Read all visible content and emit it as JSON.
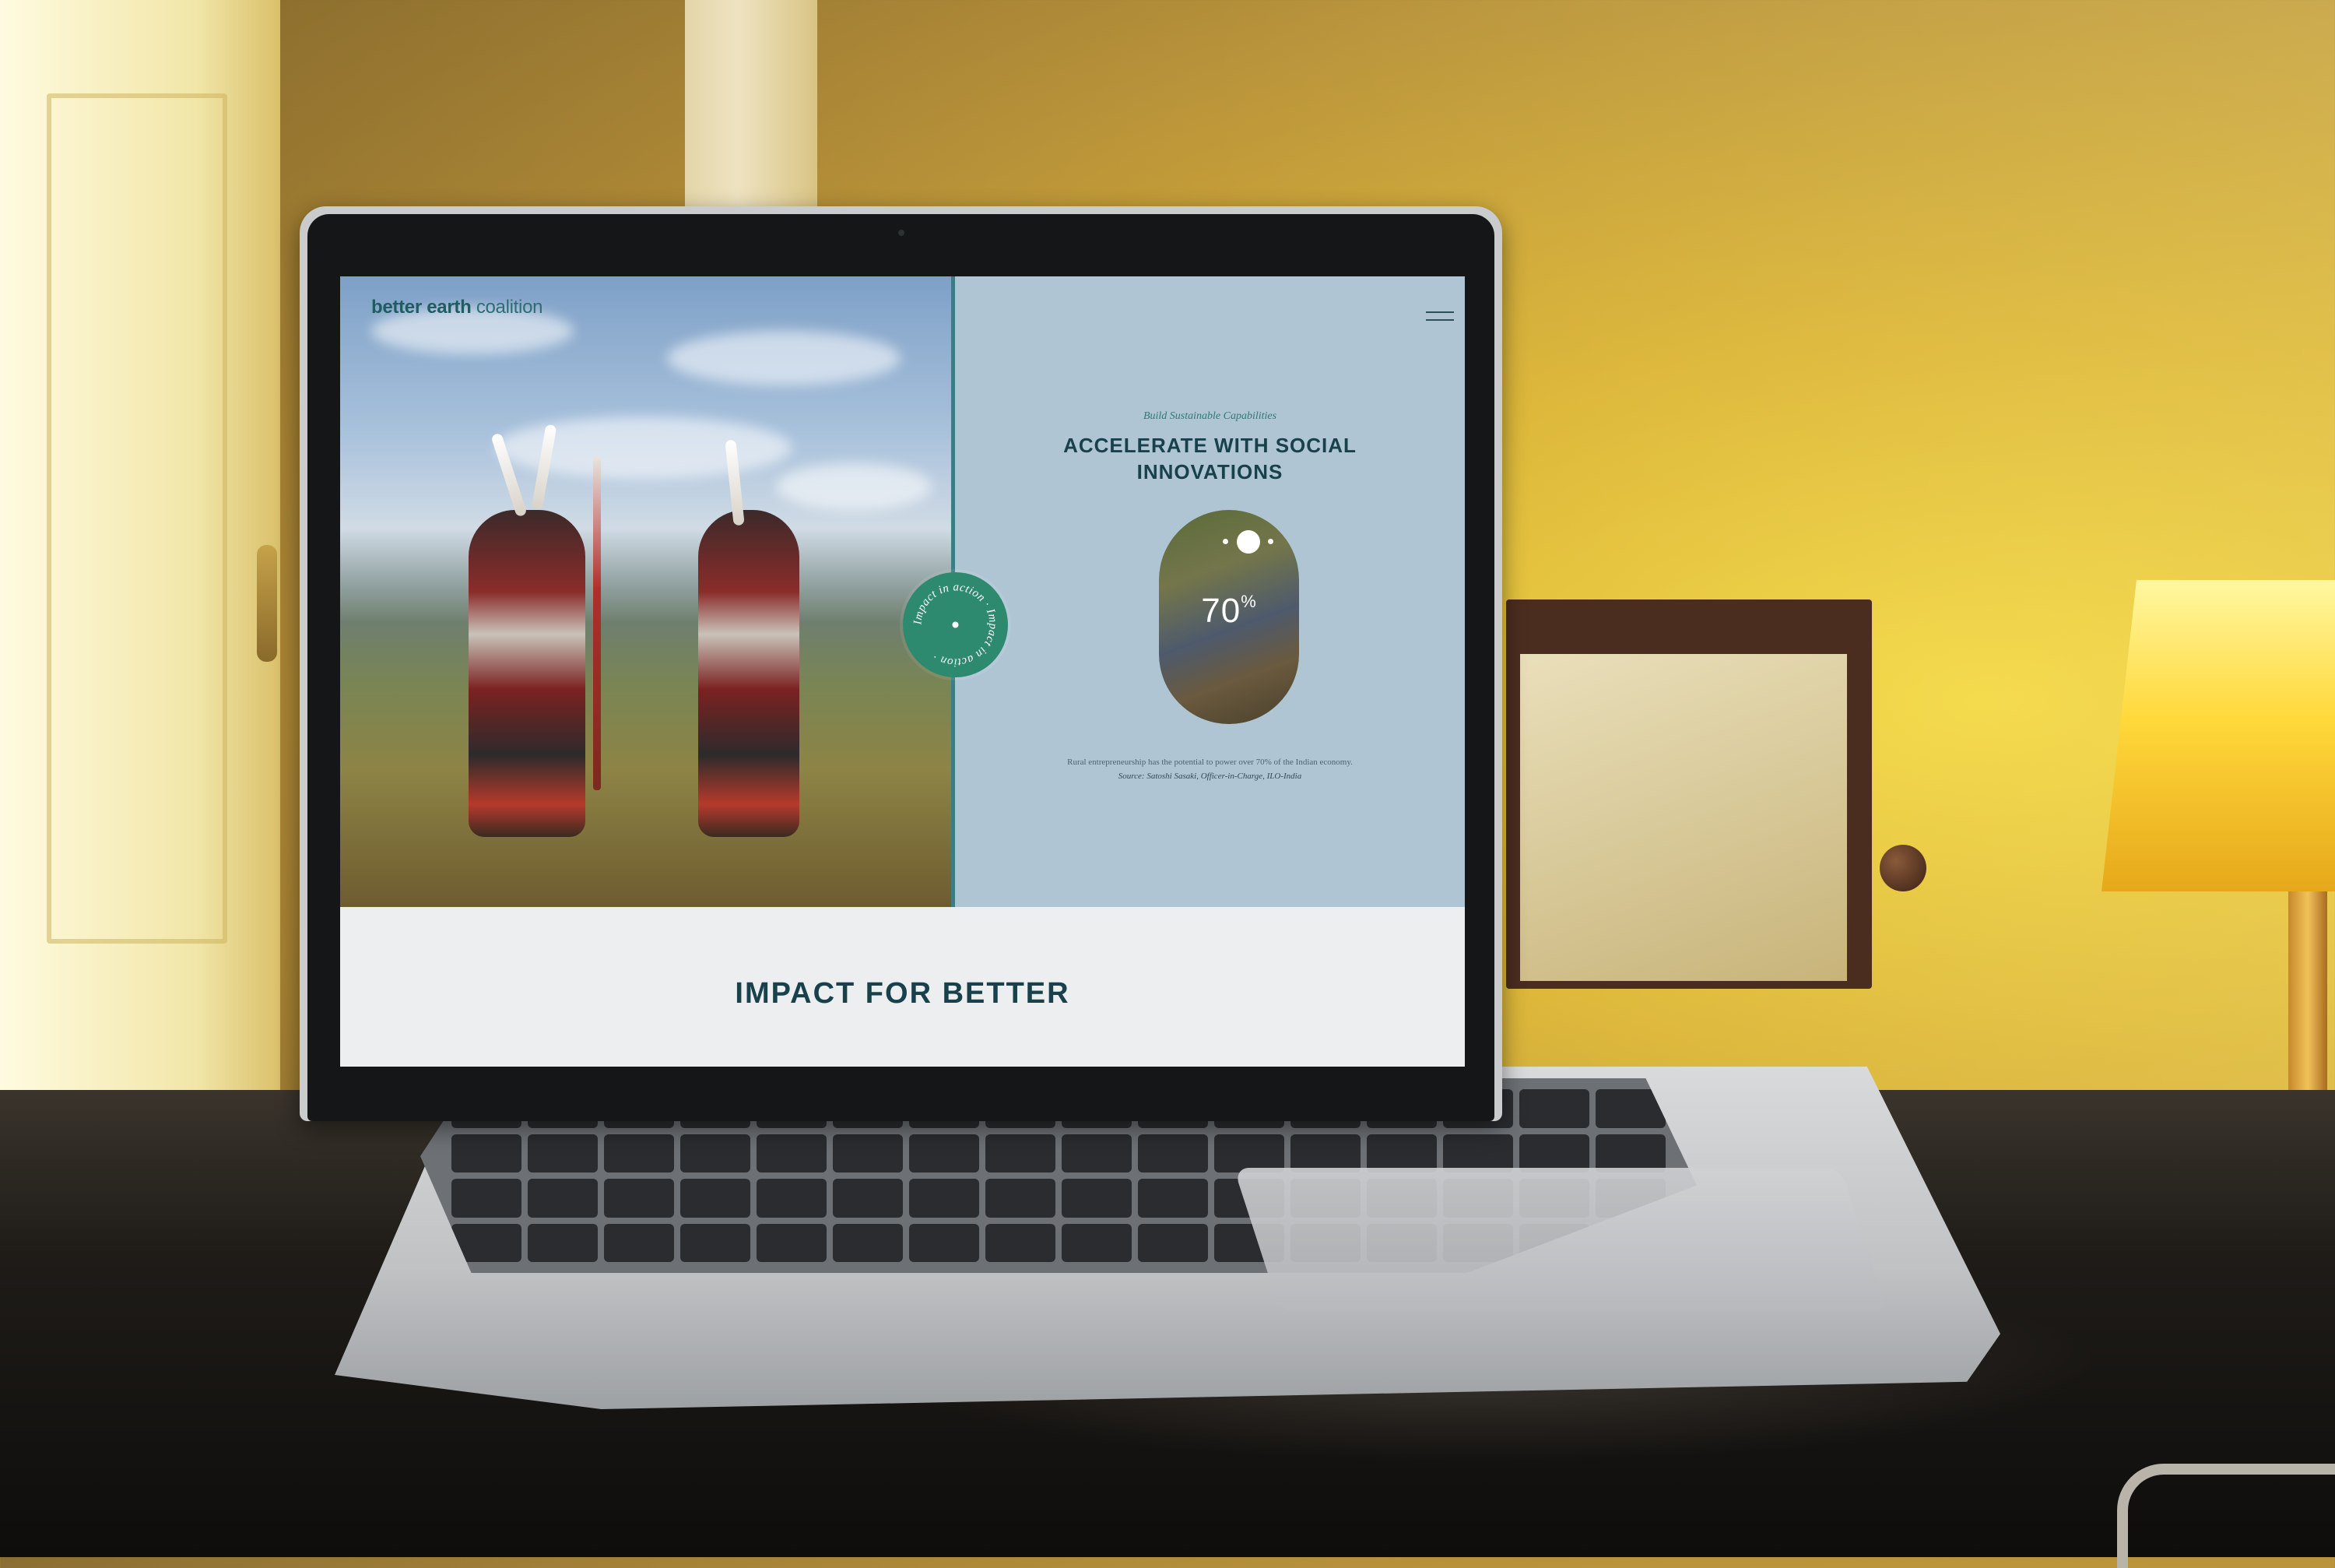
{
  "site": {
    "logo_bold": "better earth",
    "logo_light": "coalition"
  },
  "hero": {
    "badge_text": "Impact in action · Impact in action ·"
  },
  "panel": {
    "kicker": "Build Sustainable Capabilities",
    "heading": "ACCELERATE WITH SOCIAL INNOVATIONS",
    "stat_value": "70",
    "stat_unit": "%",
    "caption": "Rural entrepreneurship has the potential to power over 70% of the Indian economy.",
    "source": "Source: Satoshi Sasaki, Officer-in-Charge, ILO-India"
  },
  "section": {
    "title": "IMPACT FOR BETTER"
  },
  "colors": {
    "brand_teal": "#1f5d61",
    "panel_blue": "#afc5d4",
    "badge_green": "#2e8a6e",
    "heading_navy": "#18414b"
  }
}
